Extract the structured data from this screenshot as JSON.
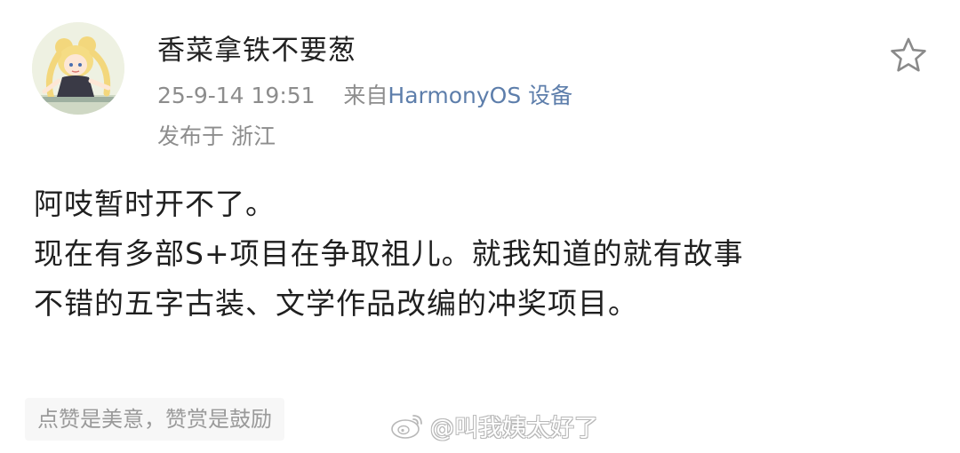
{
  "post": {
    "author": {
      "name": "香菜拿铁不要葱",
      "avatar_icon": "avatar-anime-girl"
    },
    "timestamp": "25-9-14 19:51",
    "source_prefix": "来自",
    "source_device": "HarmonyOS 设备",
    "location": "发布于 浙江",
    "favorite_icon": "star-outline-icon",
    "content_lines": [
      "阿吱暂时开不了。",
      "现在有多部S+项目在争取祖儿。就我知道的就有故事",
      "不错的五字古装、文学作品改编的冲奖项目。"
    ],
    "tip": "点赞是美意，赞赏是鼓励",
    "watermark": "@叫我姨太好了",
    "watermark_icon": "weibo-logo-icon"
  },
  "colors": {
    "link": "#5d7eab",
    "meta_text": "#8d8d8d",
    "body_text": "#1f1f1f",
    "tip_background": "#f7f7f7"
  }
}
